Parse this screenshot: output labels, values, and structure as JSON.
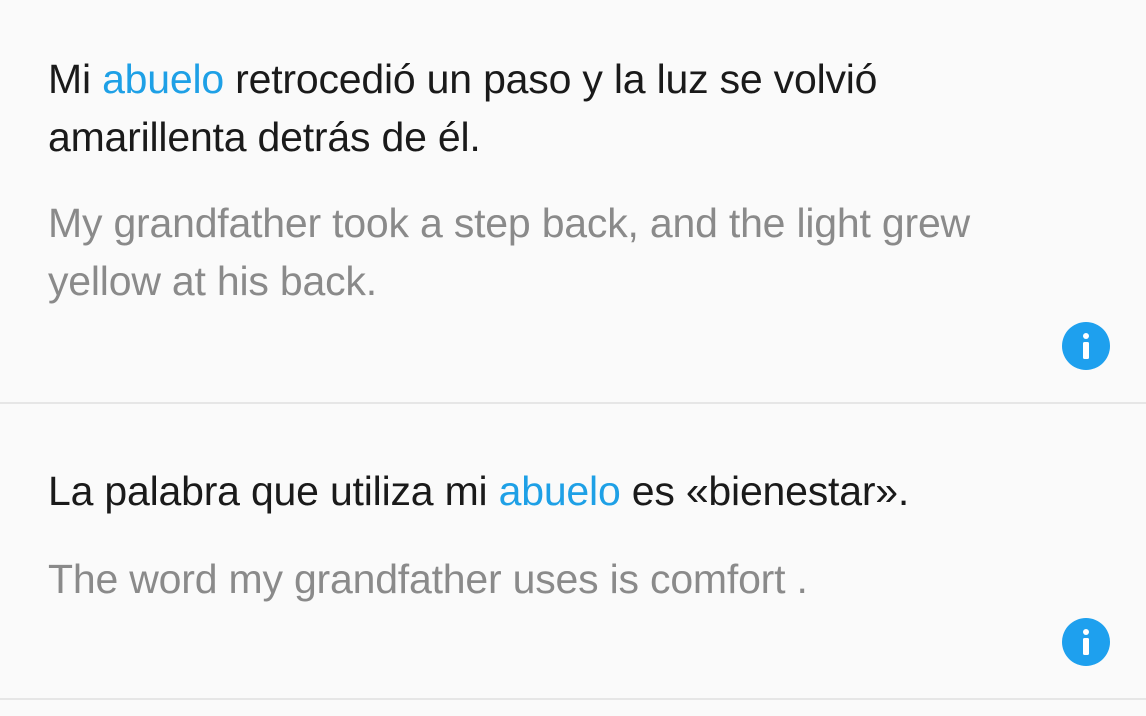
{
  "examples": [
    {
      "spanish_before": "Mi ",
      "spanish_keyword": "abuelo",
      "spanish_after": " retrocedió un paso y la luz se volvió amarillenta detrás de él.",
      "english": "My grandfather took a step back, and the light grew yellow at his back.",
      "info_icon": "info-icon"
    },
    {
      "spanish_before": "La palabra que utiliza mi ",
      "spanish_keyword": "abuelo",
      "spanish_after": " es «bienestar».",
      "english": "The word my grandfather uses is comfort .",
      "info_icon": "info-icon"
    }
  ],
  "colors": {
    "keyword": "#1ea0e6",
    "info_button": "#1ea0ee",
    "spanish_text": "#1a1a1a",
    "english_text": "#8a8a8a",
    "background": "#fafafa"
  }
}
